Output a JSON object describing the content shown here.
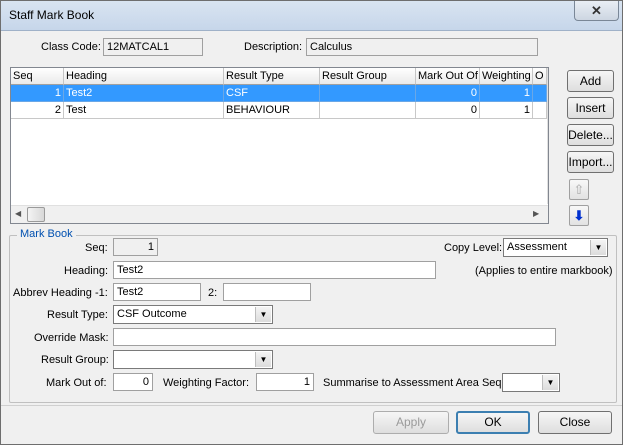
{
  "window": {
    "title": "Staff Mark Book",
    "close_glyph": "✕"
  },
  "header": {
    "class_code_label": "Class Code:",
    "class_code_value": "12MATCAL1",
    "description_label": "Description:",
    "description_value": "Calculus"
  },
  "grid": {
    "columns": [
      "Seq",
      "Heading",
      "Result Type",
      "Result Group",
      "Mark Out Of",
      "Weighting",
      "O"
    ],
    "rows": [
      {
        "seq": "1",
        "heading": "Test2",
        "result_type": "CSF",
        "result_group": "",
        "mark_out_of": "0",
        "weighting": "1",
        "selected": true
      },
      {
        "seq": "2",
        "heading": "Test",
        "result_type": "BEHAVIOUR",
        "result_group": "",
        "mark_out_of": "0",
        "weighting": "1",
        "selected": false
      }
    ]
  },
  "side_buttons": {
    "add": "Add",
    "insert": "Insert",
    "delete": "Delete...",
    "import": "Import..."
  },
  "move_icons": {
    "up": "move-up-icon",
    "down": "move-down-icon"
  },
  "markbook": {
    "group_title": "Mark Book",
    "seq_label": "Seq:",
    "seq_value": "1",
    "copy_level_label": "Copy Level:",
    "copy_level_value": "Assessment",
    "heading_label": "Heading:",
    "heading_value": "Test2",
    "applies_note": "(Applies to entire markbook)",
    "abbrev_label": "Abbrev Heading -1:",
    "abbrev1_value": "Test2",
    "abbrev2_label": "2:",
    "abbrev2_value": "",
    "result_type_label": "Result Type:",
    "result_type_value": "CSF Outcome",
    "override_mask_label": "Override Mask:",
    "override_mask_value": "",
    "result_group_label": "Result Group:",
    "result_group_value": "",
    "mark_out_of_label": "Mark Out of:",
    "mark_out_of_value": "0",
    "weighting_label": "Weighting Factor:",
    "weighting_value": "1",
    "summarise_label": "Summarise to Assessment Area Seq:",
    "summarise_value": ""
  },
  "footer": {
    "apply": "Apply",
    "ok": "OK",
    "close": "Close"
  }
}
